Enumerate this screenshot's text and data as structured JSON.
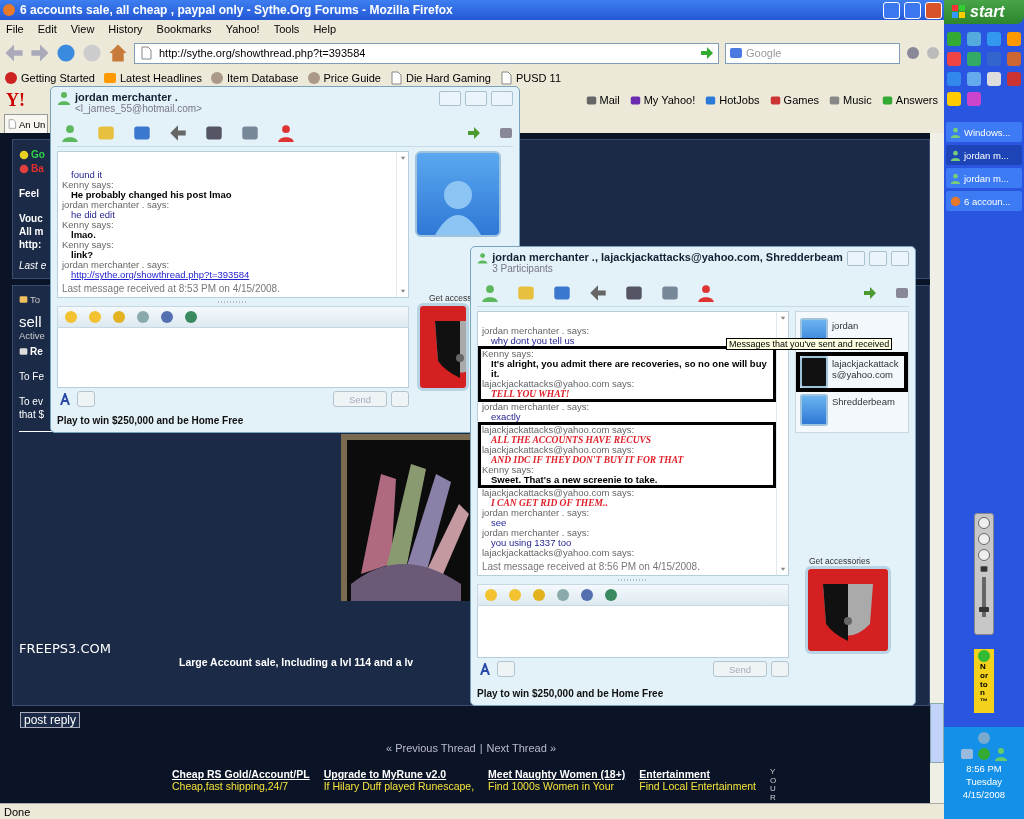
{
  "browser": {
    "title": "6 accounts sale, all cheap , paypal only - Sythe.Org Forums - Mozilla Firefox",
    "menu": [
      "File",
      "Edit",
      "View",
      "History",
      "Bookmarks",
      "Yahoo!",
      "Tools",
      "Help"
    ],
    "url": "http://sythe.org/showthread.php?t=393584",
    "search_placeholder": "Google",
    "bookmarks": [
      "Getting Started",
      "Latest Headlines",
      "Item Database",
      "Price Guide",
      "Die Hard Gaming",
      "PUSD 11"
    ],
    "yahoo_logo": "Y!",
    "yahoo_items": [
      "Mail",
      "My Yahoo!",
      "HotJobs",
      "Games",
      "Music",
      "Answers"
    ],
    "tab": "An Un",
    "status": "Done"
  },
  "forum": {
    "top_fragments": [
      {
        "text": "Go",
        "kind": "green"
      },
      {
        "text": "Ba",
        "kind": "red"
      },
      {
        "text": "Feel",
        "kind": "bold"
      },
      {
        "text": "Vouc",
        "kind": "bold"
      },
      {
        "text": "All m",
        "kind": "bold"
      },
      {
        "text": "http:",
        "kind": "bold"
      },
      {
        "text": "Last e",
        "kind": "italic"
      }
    ],
    "thread_label": "To",
    "thread_title": "sell",
    "thread_status": "Active",
    "reply_label": "Re",
    "body_lines": [
      "To Fe",
      "To ev",
      "that $"
    ],
    "site": "FREEPS3.COM",
    "sale_line": "Large Account sale, Including a lvl 114 and a lv",
    "post_reply": "post reply",
    "prev": "« Previous Thread",
    "separator": "|",
    "next": "Next Thread »",
    "ads": [
      {
        "title": "Cheap RS Gold/Account/PL",
        "text": "Cheap,fast shipping,24/7"
      },
      {
        "title": "Upgrade to MyRune v2.0",
        "text": "If Hilary Duff played Runescape,"
      },
      {
        "title": "Meet Naughty Women (18+)",
        "text": "Find 1000s Women in Your"
      },
      {
        "title": "Entertainment",
        "text": "Find Local Entertainment"
      }
    ],
    "side_label": "YOUR"
  },
  "chats": [
    {
      "title": "jordan merchanter .",
      "subtitle": "<l_james_55@hotmail.com>",
      "messages": [
        {
          "text": "found it",
          "kind": "blue",
          "highlighted": false
        },
        {
          "sender": "Kenny says:",
          "text": "He probably changed his post lmao",
          "kind": "bold",
          "highlighted": false
        },
        {
          "sender": "jordan merchanter . says:",
          "text": "he did edit",
          "kind": "blue",
          "highlighted": false
        },
        {
          "sender": "Kenny says:",
          "text": "lmao.",
          "kind": "bold",
          "highlighted": false
        },
        {
          "sender": "Kenny says:",
          "text": "link?",
          "kind": "bold",
          "highlighted": false
        },
        {
          "sender": "jordan merchanter . says:",
          "text": "http://sythe.org/showthread.php?t=393584",
          "kind": "link",
          "highlighted": false
        }
      ],
      "status": "Last message received at 8:53 PM on 4/15/2008.",
      "send": "Send",
      "accessories": "Get access",
      "ad": "Play to win $250,000 and be Home Free"
    },
    {
      "title": "jordan merchanter ., lajackjackattacks@yahoo.com, Shredderbeam",
      "subtitle": "3 Participants",
      "messages": [
        {
          "sender": "jordan merchanter . says:",
          "text": "why dont you tell us",
          "kind": "blue",
          "highlighted": false
        },
        {
          "sender": "Kenny says:",
          "text": "It's alright, you admit there are recoveries, so no one will buy it.",
          "kind": "bold",
          "highlighted": true
        },
        {
          "sender": "lajackjackattacks@yahoo.com says:",
          "text": "TELL YOU WHAT!",
          "kind": "red",
          "highlighted": true
        },
        {
          "sender": "jordan merchanter . says:",
          "text": "exactly",
          "kind": "blue",
          "highlighted": false
        },
        {
          "sender": "lajackjackattacks@yahoo.com says:",
          "text": "ALL THE ACCOUNTS HAVE RECUVS",
          "kind": "red",
          "highlighted": true
        },
        {
          "sender": "lajackjackattacks@yahoo.com says:",
          "text": "AND IDC IF THEY DON'T BUY IT FOR THAT",
          "kind": "red",
          "highlighted": true
        },
        {
          "sender": "Kenny says:",
          "text": "Sweet. That's a new screenie to take.",
          "kind": "bold",
          "highlighted": true
        },
        {
          "sender": "lajackjackattacks@yahoo.com says:",
          "text": "I CAN GET RID OF THEM..",
          "kind": "red",
          "highlighted": false
        },
        {
          "sender": "jordan merchanter . says:",
          "text": "see",
          "kind": "blue",
          "highlighted": false
        },
        {
          "sender": "jordan merchanter . says:",
          "text": "you using 1337 too",
          "kind": "blue",
          "highlighted": false
        },
        {
          "sender": "lajackjackattacks@yahoo.com says:",
          "highlighted": false
        }
      ],
      "status": "Last message received at 8:56 PM on 4/15/2008.",
      "send": "Send",
      "accessories": "Get accessories",
      "ad": "Play to win $250,000 and be Home Free",
      "participants": [
        {
          "name": "jordan",
          "selected": false
        },
        {
          "name": "lajackjackattacks@yahoo.com",
          "selected": true
        },
        {
          "name": "Shredderbeam",
          "selected": false
        }
      ],
      "tooltip": "Messages that you've sent and received"
    }
  ],
  "taskbar": {
    "start": "start",
    "tasks": [
      {
        "label": "Windows...",
        "selected": false
      },
      {
        "label": "jordan m...",
        "selected": true
      },
      {
        "label": "jordan m...",
        "selected": false
      },
      {
        "label": "6 accoun...",
        "selected": false
      }
    ],
    "volume": {
      "level": 0.2
    },
    "norton": "Norton™",
    "time": "8:56 PM",
    "day": "Tuesday",
    "date": "4/15/2008"
  }
}
